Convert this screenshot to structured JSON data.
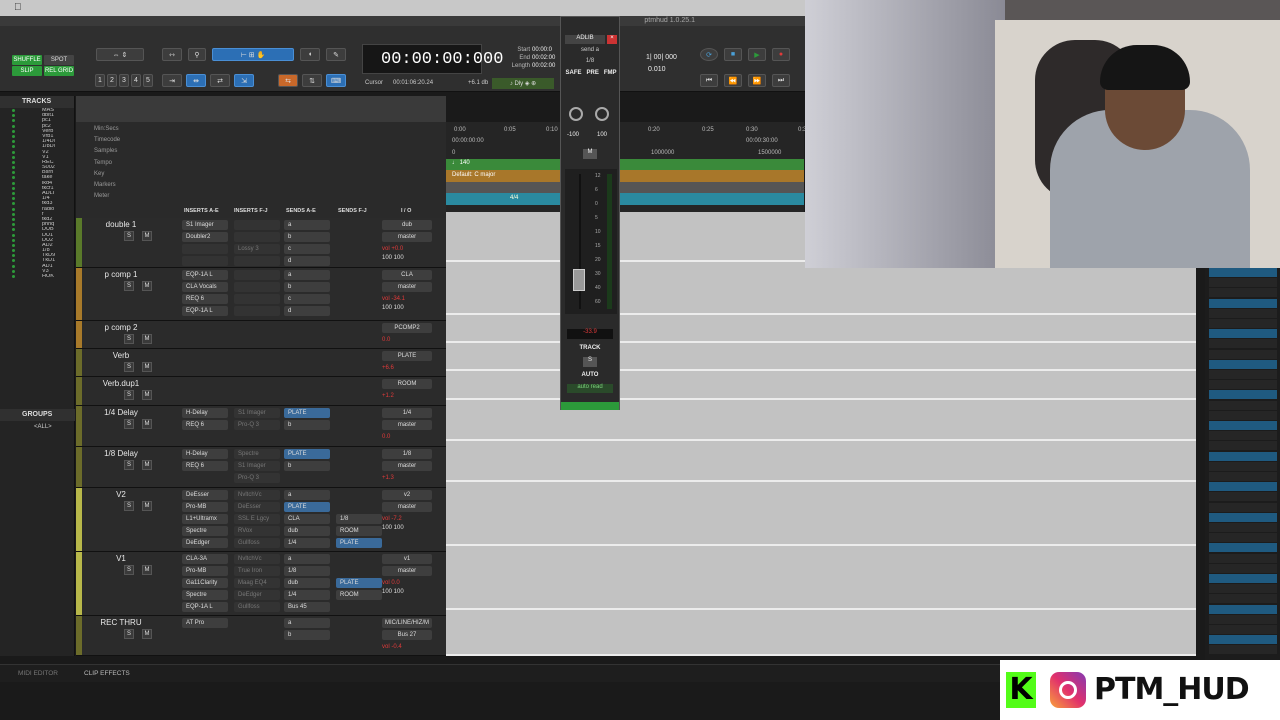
{
  "app": {
    "version": "ptmhud 1.0.25.1"
  },
  "toolbar": {
    "modes": [
      "SHUFFLE",
      "SPOT",
      "SLIP",
      "REL GRID"
    ],
    "counter": "00:00:00:000",
    "cursor_label": "Cursor",
    "cursor_value": "00:01:06:20.24",
    "gain": "+6.1 db",
    "sel_labels": [
      "Start",
      "End",
      "Length"
    ],
    "sel_values": [
      "00:00:0",
      "00:02:00",
      "00:02:00"
    ],
    "nums": [
      "1",
      "2",
      "3",
      "4",
      "5"
    ],
    "grid_val": "1| 00| 000",
    "nudge_val": "0.010"
  },
  "colors": {
    "accent": "#2c6fb5",
    "vol_red": "#e03a3a",
    "active_blue": "#4aa0d8"
  },
  "tracks_list": {
    "title": "TRACKS",
    "items": [
      "MAS",
      "dblt1",
      "pc1",
      "pc2",
      "Verb",
      "Vrb1",
      "1/4Dl",
      "1/8Dl",
      "V2",
      "V1",
      "REC",
      "S002",
      "Bsrn",
      "take",
      "lkd4",
      "tkcf1",
      "ADLI",
      "1/4",
      "tkd3",
      "radio",
      "f",
      "tkd2",
      "phnq",
      "DUB",
      "DU1",
      "DU2",
      "AD2",
      "1/8",
      "TkD9",
      "TkD1",
      "AD1",
      "V3",
      "HOK"
    ]
  },
  "groups": {
    "title": "GROUPS",
    "item": "<ALL>"
  },
  "ruler": {
    "labels": [
      "Min:Secs",
      "Timecode",
      "Samples",
      "Tempo",
      "Key",
      "Markers",
      "Meter"
    ],
    "min_secs": [
      "0:00",
      "0:05",
      "0:10",
      "0:20",
      "0:25",
      "0:30",
      "0:35"
    ],
    "timecode": [
      "00:00:00:00",
      "00:00:30:00"
    ],
    "samples": [
      "0",
      "1000000",
      "1500000"
    ],
    "tempo": "♩ 140",
    "key": "Default: C major",
    "meter": "4/4"
  },
  "columns": [
    "INSERTS A-E",
    "INSERTS F-J",
    "SENDS A-E",
    "SENDS F-J",
    "I / O"
  ],
  "mix_tracks": [
    {
      "name": "double 1",
      "ins_a": [
        "S1 Imager",
        "Doubler2",
        "",
        ""
      ],
      "ins_f": [
        "",
        "",
        "Lossy 3",
        ""
      ],
      "sends": [
        "a",
        "b",
        "c",
        "d"
      ],
      "io": [
        "dub",
        "master"
      ],
      "vol": "vol +0.0",
      "pan": "100 100"
    },
    {
      "name": "p comp 1",
      "ins_a": [
        "EQP-1A L",
        "CLA Vocals",
        "REQ 6",
        "EQP-1A L"
      ],
      "ins_f": [
        "",
        "",
        "",
        ""
      ],
      "sends": [
        "a",
        "b",
        "c",
        "d"
      ],
      "io": [
        "CLA",
        "master"
      ],
      "vol": "vol -34.1",
      "pan": "100 100"
    },
    {
      "name": "p comp 2",
      "ins_a": [],
      "ins_f": [],
      "sends": [],
      "io": [
        "PCOMP2"
      ],
      "vol": "0.0",
      "pan": ""
    },
    {
      "name": "Verb",
      "ins_a": [],
      "ins_f": [],
      "sends": [],
      "io": [
        "PLATE"
      ],
      "vol": "+6.6",
      "pan": ""
    },
    {
      "name": "Verb.dup1",
      "ins_a": [],
      "ins_f": [],
      "sends": [],
      "io": [
        "ROOM"
      ],
      "vol": "+1.2",
      "pan": ""
    },
    {
      "name": "1/4 Delay",
      "ins_a": [
        "H-Delay",
        "REQ 6"
      ],
      "ins_f": [
        "S1 Imager",
        "Pro-Q 3"
      ],
      "sends": [
        "PLATE",
        "b"
      ],
      "io": [
        "1/4",
        "master"
      ],
      "vol": "0.0",
      "pan": ""
    },
    {
      "name": "1/8 Delay",
      "ins_a": [
        "H-Delay",
        "REQ 6"
      ],
      "ins_f": [
        "Spectre",
        "S1 Imager",
        "Pro-Q 3"
      ],
      "sends": [
        "PLATE",
        "b"
      ],
      "io": [
        "1/8",
        "master"
      ],
      "vol": "+1.3",
      "pan": ""
    },
    {
      "name": "V2",
      "ins_a": [
        "DeEsser",
        "Pro-MB",
        "L1+Ultramx",
        "Spectre",
        "DeEdger"
      ],
      "ins_f": [
        "NvltchVc",
        "DeEsser",
        "SSL E Lgcy",
        "RVox",
        "Gullfoss"
      ],
      "sends": [
        "a",
        "PLATE",
        "CLA",
        "dub",
        "1/4"
      ],
      "io": [
        "v2",
        "master"
      ],
      "vol": "vol -7.2",
      "pan": "100 100",
      "sends2": [
        "1/8",
        "ROOM",
        "PLATE"
      ]
    },
    {
      "name": "V1",
      "ins_a": [
        "CLA-3A",
        "Pro-MB",
        "Ga11Clarity",
        "Spectre",
        "EQP-1A L"
      ],
      "ins_f": [
        "NvltchVc",
        "True Iron",
        "Maag EQ4",
        "DeEdger",
        "Gullfoss"
      ],
      "sends": [
        "a",
        "1/8",
        "dub",
        "1/4",
        "Bus 45"
      ],
      "io": [
        "v1",
        "master"
      ],
      "vol": "vol 0.0",
      "pan": "100 100",
      "sends2": [
        "PLATE",
        "ROOM"
      ]
    },
    {
      "name": "REC THRU",
      "ins_a": [
        "AT Pro"
      ],
      "ins_f": [],
      "sends": [
        "a",
        "b"
      ],
      "io": [
        "MIC/LINE/HIZ/M",
        "Bus 27"
      ],
      "vol": "vol -0.4",
      "pan": ""
    }
  ],
  "mixer_float": {
    "name": "ADLIB",
    "send": "send a",
    "sub": "1/8",
    "btns": [
      "SAFE",
      "PRE",
      "FMP"
    ],
    "pan": [
      "-100",
      "100"
    ],
    "m": "M",
    "fader_val": "-33.9",
    "track": "TRACK",
    "s": "S",
    "auto": "AUTO",
    "auto_mode": "auto read",
    "scale": [
      "12",
      "6",
      "0",
      "5",
      "10",
      "15",
      "20",
      "30",
      "40",
      "60"
    ]
  },
  "bottom": {
    "tabs": [
      "MIDI EDITOR",
      "CLIP EFFECTS"
    ]
  },
  "social": {
    "handle": "PTM_HUD"
  }
}
